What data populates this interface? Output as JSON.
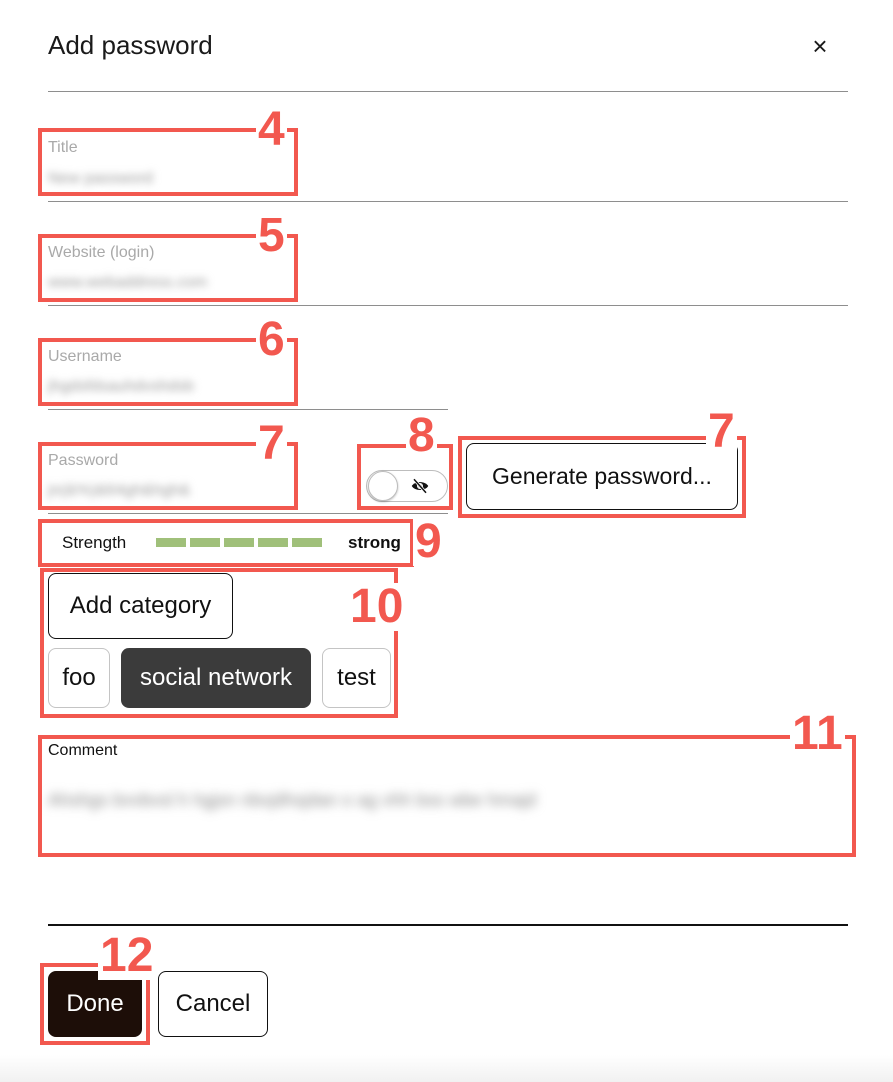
{
  "dialog": {
    "title": "Add password",
    "close_icon": "×"
  },
  "fields": {
    "title": {
      "label": "Title",
      "value": "New password"
    },
    "website": {
      "label": "Website (login)",
      "value": "www.webaddress.com"
    },
    "username": {
      "label": "Username",
      "value": "jhgdsfdsauhdvshdsb"
    },
    "password": {
      "label": "Password",
      "value": "jn(&%)&64gh&hgh&"
    }
  },
  "visibility_toggle": {
    "icon": "eye-off-icon",
    "on": false
  },
  "generate_button": {
    "label": "Generate password..."
  },
  "strength": {
    "label": "Strength",
    "value": "strong",
    "segments_filled": 5,
    "segments_total": 5,
    "color": "#a0c07a"
  },
  "categories": {
    "add_label": "Add category",
    "items": [
      {
        "label": "foo",
        "selected": false
      },
      {
        "label": "social network",
        "selected": true
      },
      {
        "label": "test",
        "selected": false
      }
    ]
  },
  "comment": {
    "label": "Comment",
    "value": "Ahshgs bvvbvsl h hgjsn nbvjdhsjdan o ag vhh bss wbe hmajd"
  },
  "footer": {
    "done_label": "Done",
    "cancel_label": "Cancel",
    "done_color": "#1d0e08"
  },
  "annotations": {
    "color": "#f2584f",
    "labels": [
      "4",
      "5",
      "6",
      "7",
      "8",
      "7",
      "9",
      "10",
      "11",
      "12"
    ]
  }
}
